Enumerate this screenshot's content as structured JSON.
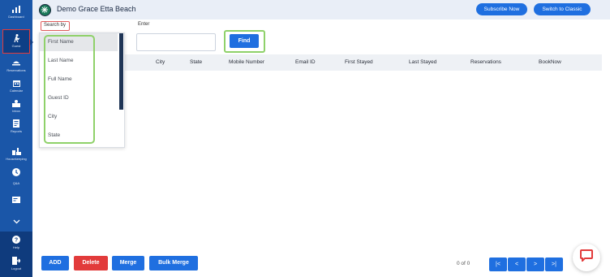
{
  "sidebar": {
    "items": [
      {
        "label": "Dashboard",
        "icon": "dashboard-icon"
      },
      {
        "label": "Guest",
        "icon": "guest-icon"
      },
      {
        "label": "Reservations",
        "icon": "reservations-icon"
      },
      {
        "label": "Calendar",
        "icon": "calendar-icon"
      },
      {
        "label": "Inbox",
        "icon": "inbox-icon"
      },
      {
        "label": "Reports",
        "icon": "reports-icon"
      },
      {
        "label": "Housekeeping",
        "icon": "housekeeping-icon"
      },
      {
        "label": "Q&A",
        "icon": "qa-icon"
      }
    ],
    "bottom": [
      {
        "label": "Help",
        "icon": "help-icon"
      },
      {
        "label": "Logout",
        "icon": "logout-icon"
      }
    ],
    "active_color": "#e23b3b",
    "bg_color": "#1a56a8"
  },
  "header": {
    "title": "Demo Grace Etta Beach",
    "subscribe_label": "Subscribe Now",
    "classic_label": "Switch to Classic"
  },
  "search": {
    "search_by_label": "Search by",
    "enter_label": "Enter",
    "enter_value": "",
    "find_label": "Find",
    "options": [
      "First Name",
      "Last Name",
      "Full Name",
      "Guest ID",
      "City",
      "State"
    ],
    "selected": "First Name"
  },
  "table": {
    "columns": [
      "City",
      "State",
      "Mobile Number",
      "Email ID",
      "First Stayed",
      "Last Stayed",
      "Reservations",
      "BookNow"
    ]
  },
  "footer": {
    "add_label": "ADD",
    "delete_label": "Delete",
    "merge_label": "Merge",
    "bulk_merge_label": "Bulk Merge",
    "pager_text": "0 of 0",
    "pager": {
      "first": "|<",
      "prev": "<",
      "next": ">",
      "last": ">|"
    }
  },
  "colors": {
    "accent": "#1f6fe0",
    "danger": "#e23b3b",
    "highlight_green": "#8fd16a"
  }
}
